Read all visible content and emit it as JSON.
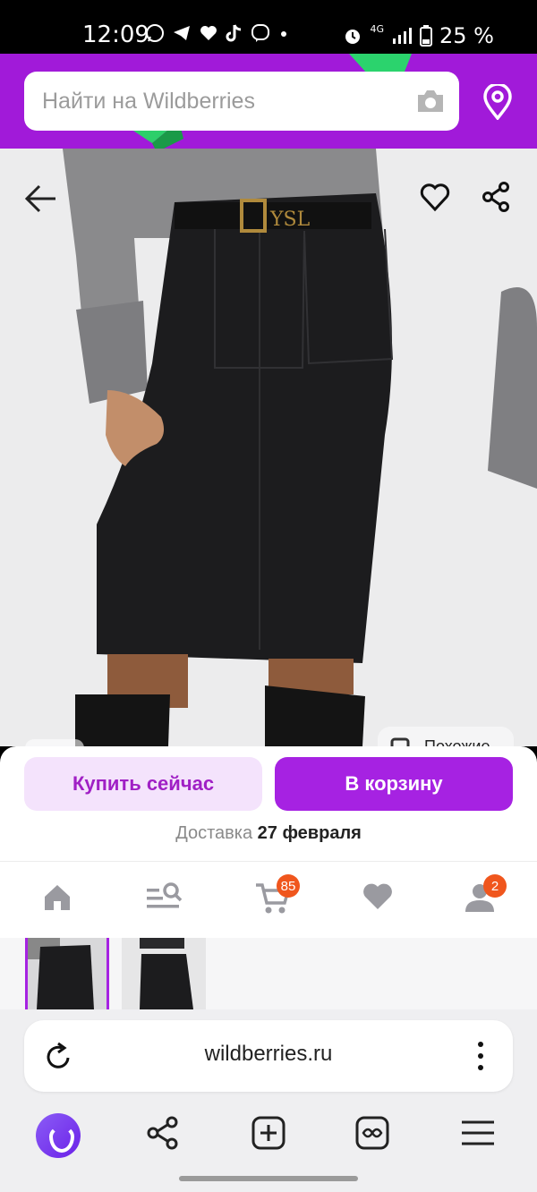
{
  "status_bar": {
    "time": "12:09",
    "network": "4G",
    "battery": "25 %"
  },
  "search": {
    "placeholder": "Найти на Wildberries"
  },
  "product": {
    "similar_label": "Похожие"
  },
  "actions": {
    "buy_now_label": "Купить сейчас",
    "add_to_cart_label": "В корзину",
    "delivery_label": "Доставка",
    "delivery_date": "27 февраля"
  },
  "nav": {
    "cart_count": "85",
    "profile_count": "2"
  },
  "browser": {
    "url": "wildberries.ru"
  },
  "colors": {
    "brand": "#a622e2",
    "header": "#a11ad9",
    "badge": "#f0561d"
  }
}
